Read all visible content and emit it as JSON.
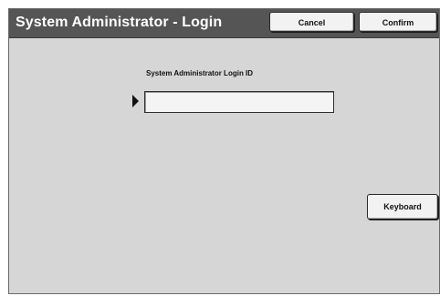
{
  "window": {
    "title": "System Administrator - Login"
  },
  "header": {
    "cancel_label": "Cancel",
    "confirm_label": "Confirm"
  },
  "login": {
    "label": "System Administrator Login ID",
    "value": "",
    "placeholder": ""
  },
  "actions": {
    "keyboard_label": "Keyboard"
  },
  "icons": {
    "field_pointer": "triangle-pointer-right-icon"
  },
  "colors": {
    "title_bar": "#555555",
    "panel": "#d6d6d6",
    "button_face": "#f2f2f2",
    "field_face": "#f4f4f4"
  }
}
